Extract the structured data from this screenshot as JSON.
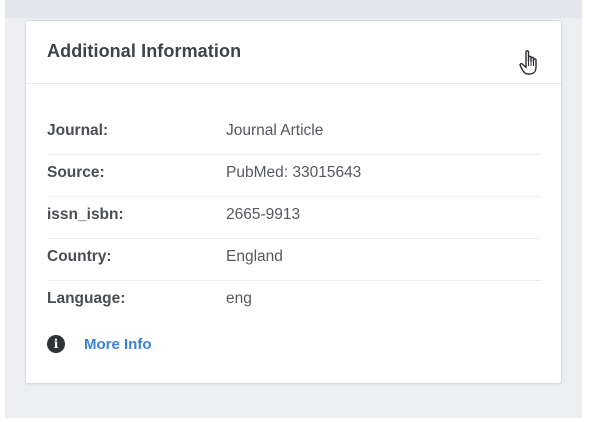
{
  "card": {
    "title": "Additional Information",
    "toggle_icon": "hand-pointer-icon"
  },
  "details": [
    {
      "label": "Journal:",
      "value": "Journal Article"
    },
    {
      "label": "Source:",
      "value": "PubMed: 33015643"
    },
    {
      "label": "issn_isbn:",
      "value": "2665-9913"
    },
    {
      "label": "Country:",
      "value": "England"
    },
    {
      "label": "Language:",
      "value": "eng"
    }
  ],
  "more_info": {
    "icon": "info-icon",
    "label": "More Info",
    "color": "#3b82d6"
  }
}
